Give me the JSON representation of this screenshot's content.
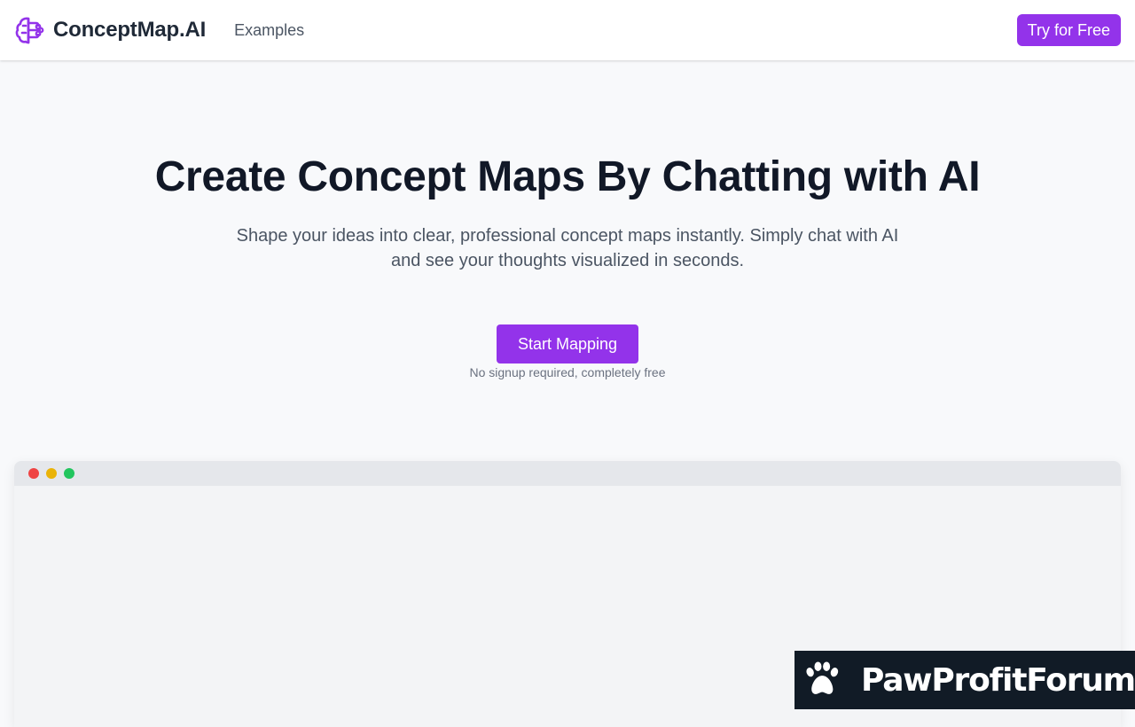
{
  "header": {
    "brand_name": "ConceptMap.AI",
    "brand_icon": "brain-icon",
    "nav_examples": "Examples",
    "cta_label": "Try for Free"
  },
  "hero": {
    "title": "Create Concept Maps By Chatting with AI",
    "subtitle": "Shape your ideas into clear, professional concept maps instantly. Simply chat with AI and see your thoughts visualized in seconds.",
    "start_button": "Start Mapping",
    "note": "No signup required, completely free"
  },
  "preview": {
    "window_dots": [
      "red",
      "yellow",
      "green"
    ]
  },
  "watermark": {
    "text": "PawProfitForum",
    "icon": "paw-icon"
  },
  "colors": {
    "accent": "#9333ea",
    "page_bg": "#f8f9fb",
    "heading": "#111827",
    "body_text": "#4b5563",
    "dot_red": "#ef4444",
    "dot_yellow": "#eab308",
    "dot_green": "#22c55e",
    "watermark_bg": "#111b26"
  }
}
